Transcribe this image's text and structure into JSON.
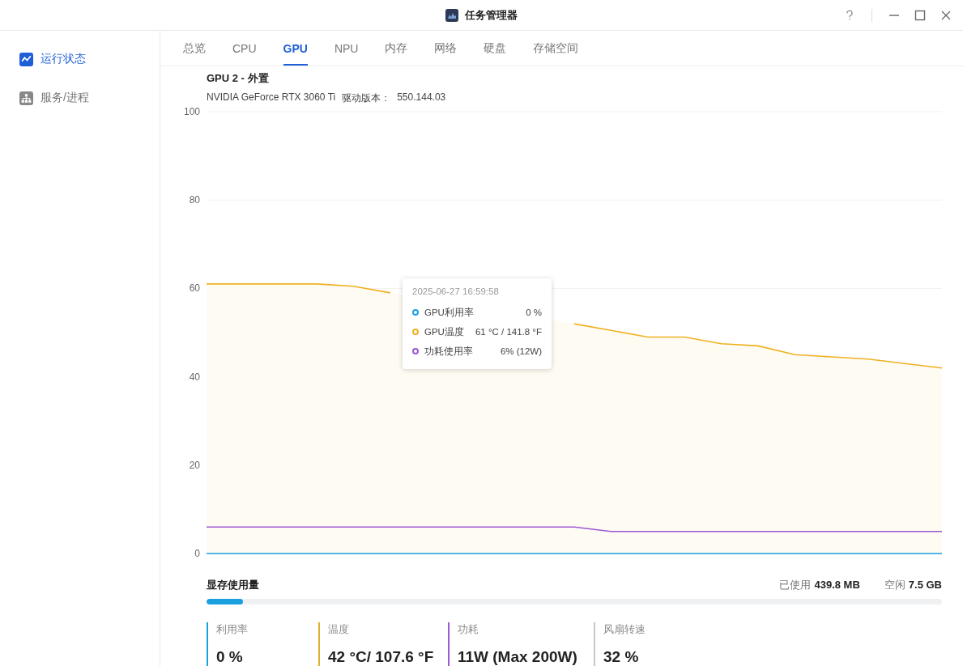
{
  "window": {
    "title": "任务管理器"
  },
  "sidebar": {
    "items": [
      {
        "label": "运行状态",
        "selected": true
      },
      {
        "label": "服务/进程",
        "selected": false
      }
    ]
  },
  "tabs": [
    {
      "label": "总览",
      "selected": false
    },
    {
      "label": "CPU",
      "selected": false
    },
    {
      "label": "GPU",
      "selected": true
    },
    {
      "label": "NPU",
      "selected": false
    },
    {
      "label": "内存",
      "selected": false
    },
    {
      "label": "网络",
      "selected": false
    },
    {
      "label": "硬盘",
      "selected": false
    },
    {
      "label": "存储空间",
      "selected": false
    }
  ],
  "gpu": {
    "title": "GPU 2 - 外置",
    "model": "NVIDIA GeForce RTX 3060 Ti",
    "driver_label": "驱动版本：",
    "driver_version": "550.144.03"
  },
  "chart_data": {
    "type": "line",
    "ylim": [
      0,
      100
    ],
    "yticks": [
      0,
      20,
      40,
      60,
      80,
      100
    ],
    "legend": true,
    "series": [
      {
        "name": "GPU利用率",
        "color": "#1aa0e0",
        "values": [
          0,
          0,
          0,
          0,
          0,
          0,
          0,
          0,
          0,
          0,
          0,
          0,
          0,
          0,
          0,
          0,
          0,
          0,
          0,
          0,
          0
        ]
      },
      {
        "name": "GPU温度",
        "color": "#f0b020",
        "values": [
          61,
          61,
          61,
          61,
          60.5,
          59,
          null,
          null,
          null,
          null,
          52,
          50.5,
          49,
          49,
          47.5,
          47,
          45,
          44.5,
          44,
          43,
          42
        ]
      },
      {
        "name": "功耗使用率",
        "color": "#9b59d6",
        "values": [
          6,
          6,
          6,
          6,
          6,
          6,
          6,
          6,
          6,
          6,
          6,
          5,
          5,
          5,
          5,
          5,
          5,
          5,
          5,
          5,
          5
        ]
      }
    ]
  },
  "tooltip": {
    "time": "2025-06-27 16:59:58",
    "values": [
      "0 %",
      "61 °C / 141.8 °F",
      "6% (12W)"
    ]
  },
  "memory": {
    "title": "显存使用量",
    "used_label": "已使用",
    "used": "439.8 MB",
    "free_label": "空闲",
    "free": "7.5 GB",
    "level": 0.05
  },
  "stats": [
    {
      "label": "利用率",
      "value": "0 %",
      "color": "#1aa0e0"
    },
    {
      "label": "温度",
      "value": "42 °C/ 107.6 °F",
      "color": "#e0b030"
    },
    {
      "label": "功耗",
      "value": "11W (Max 200W)",
      "color": "#9b59d6"
    },
    {
      "label": "风扇转速",
      "value": "32 %",
      "color": "#c8c8c8"
    }
  ]
}
